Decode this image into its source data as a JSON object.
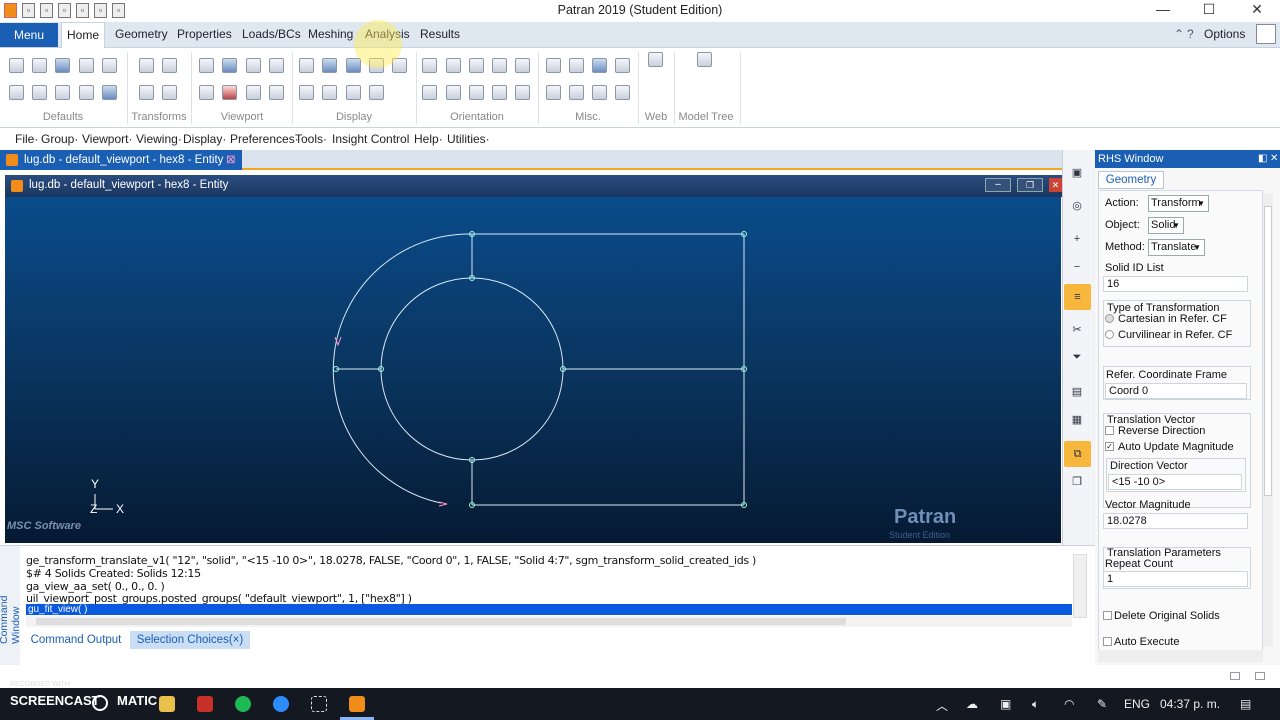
{
  "window": {
    "title": "Patran 2019  (Student Edition)"
  },
  "ribbon": {
    "menu_label": "Menu",
    "tabs": [
      "Home",
      "Geometry",
      "Properties",
      "Loads/BCs",
      "Meshing",
      "Analysis",
      "Results"
    ],
    "options_label": "Options",
    "groups": [
      "Defaults",
      "Transforms",
      "Viewport",
      "Display",
      "Orientation",
      "Misc.",
      "Web",
      "Model Tree"
    ]
  },
  "menubar": [
    "File",
    "Group",
    "Viewport",
    "Viewing",
    "Display",
    "Preferences",
    "Tools",
    "Insight Control",
    "Help",
    "Utilities"
  ],
  "document": {
    "tab_label": "lug.db - default_viewport - hex8 - Entity",
    "viewport_title": "lug.db - default_viewport - hex8 - Entity",
    "axis": {
      "y": "Y",
      "z": "Z",
      "x": "X"
    },
    "msc_logo": "MSC Software",
    "watermark": "Patran",
    "watermark_sub": "Student Edition"
  },
  "rhs": {
    "title": "RHS Window",
    "tab": "Geometry",
    "action_label": "Action:",
    "action_value": "Transform",
    "object_label": "Object:",
    "object_value": "Solid",
    "method_label": "Method:",
    "method_value": "Translate",
    "solid_id_label": "Solid ID List",
    "solid_id_value": "16",
    "type_label": "Type of Transformation",
    "type_opt1": "Cartesian in Refer. CF",
    "type_opt2": "Curvilinear in Refer. CF",
    "ref_cf_label": "Refer. Coordinate Frame",
    "ref_cf_value": "Coord 0",
    "translation_vector_label": "Translation Vector",
    "reverse_direction": "Reverse Direction",
    "auto_update": "Auto Update Magnitude",
    "direction_vector_label": "Direction Vector",
    "direction_vector_value": "<15 -10 0>",
    "vector_magnitude_label": "Vector Magnitude",
    "vector_magnitude_value": "18.0278",
    "translation_params_label": "Translation Parameters",
    "repeat_count_label": "Repeat Count",
    "repeat_count_value": "1",
    "delete_original": "Delete Original Solids",
    "auto_execute": "Auto Execute"
  },
  "command": {
    "side_label": "Command Window",
    "lines": [
      "ge_transform_translate_v1( \"12\", \"solid\", \"<15 -10 0>\", 18.0278, FALSE, \"Coord 0\", 1, FALSE, \"Solid 4:7\", sgm_transform_solid_created_ids )",
      "$# 4 Solids Created: Solids 12:15",
      "ga_view_aa_set( 0., 0., 0. )",
      "uil_viewport_post_groups.posted_groups( \"default_viewport\", 1, [\"hex8\"] )"
    ],
    "highlight_line": "gu_fit_view( )",
    "tab_output": "Command Output",
    "tab_selection": "Selection Choices(×)"
  },
  "taskbar": {
    "recorded_with": "RECORDED WITH",
    "screencast": "SCREENCAST",
    "matic": "MATIC",
    "lang": "ENG",
    "time": "04:37 p. m."
  }
}
